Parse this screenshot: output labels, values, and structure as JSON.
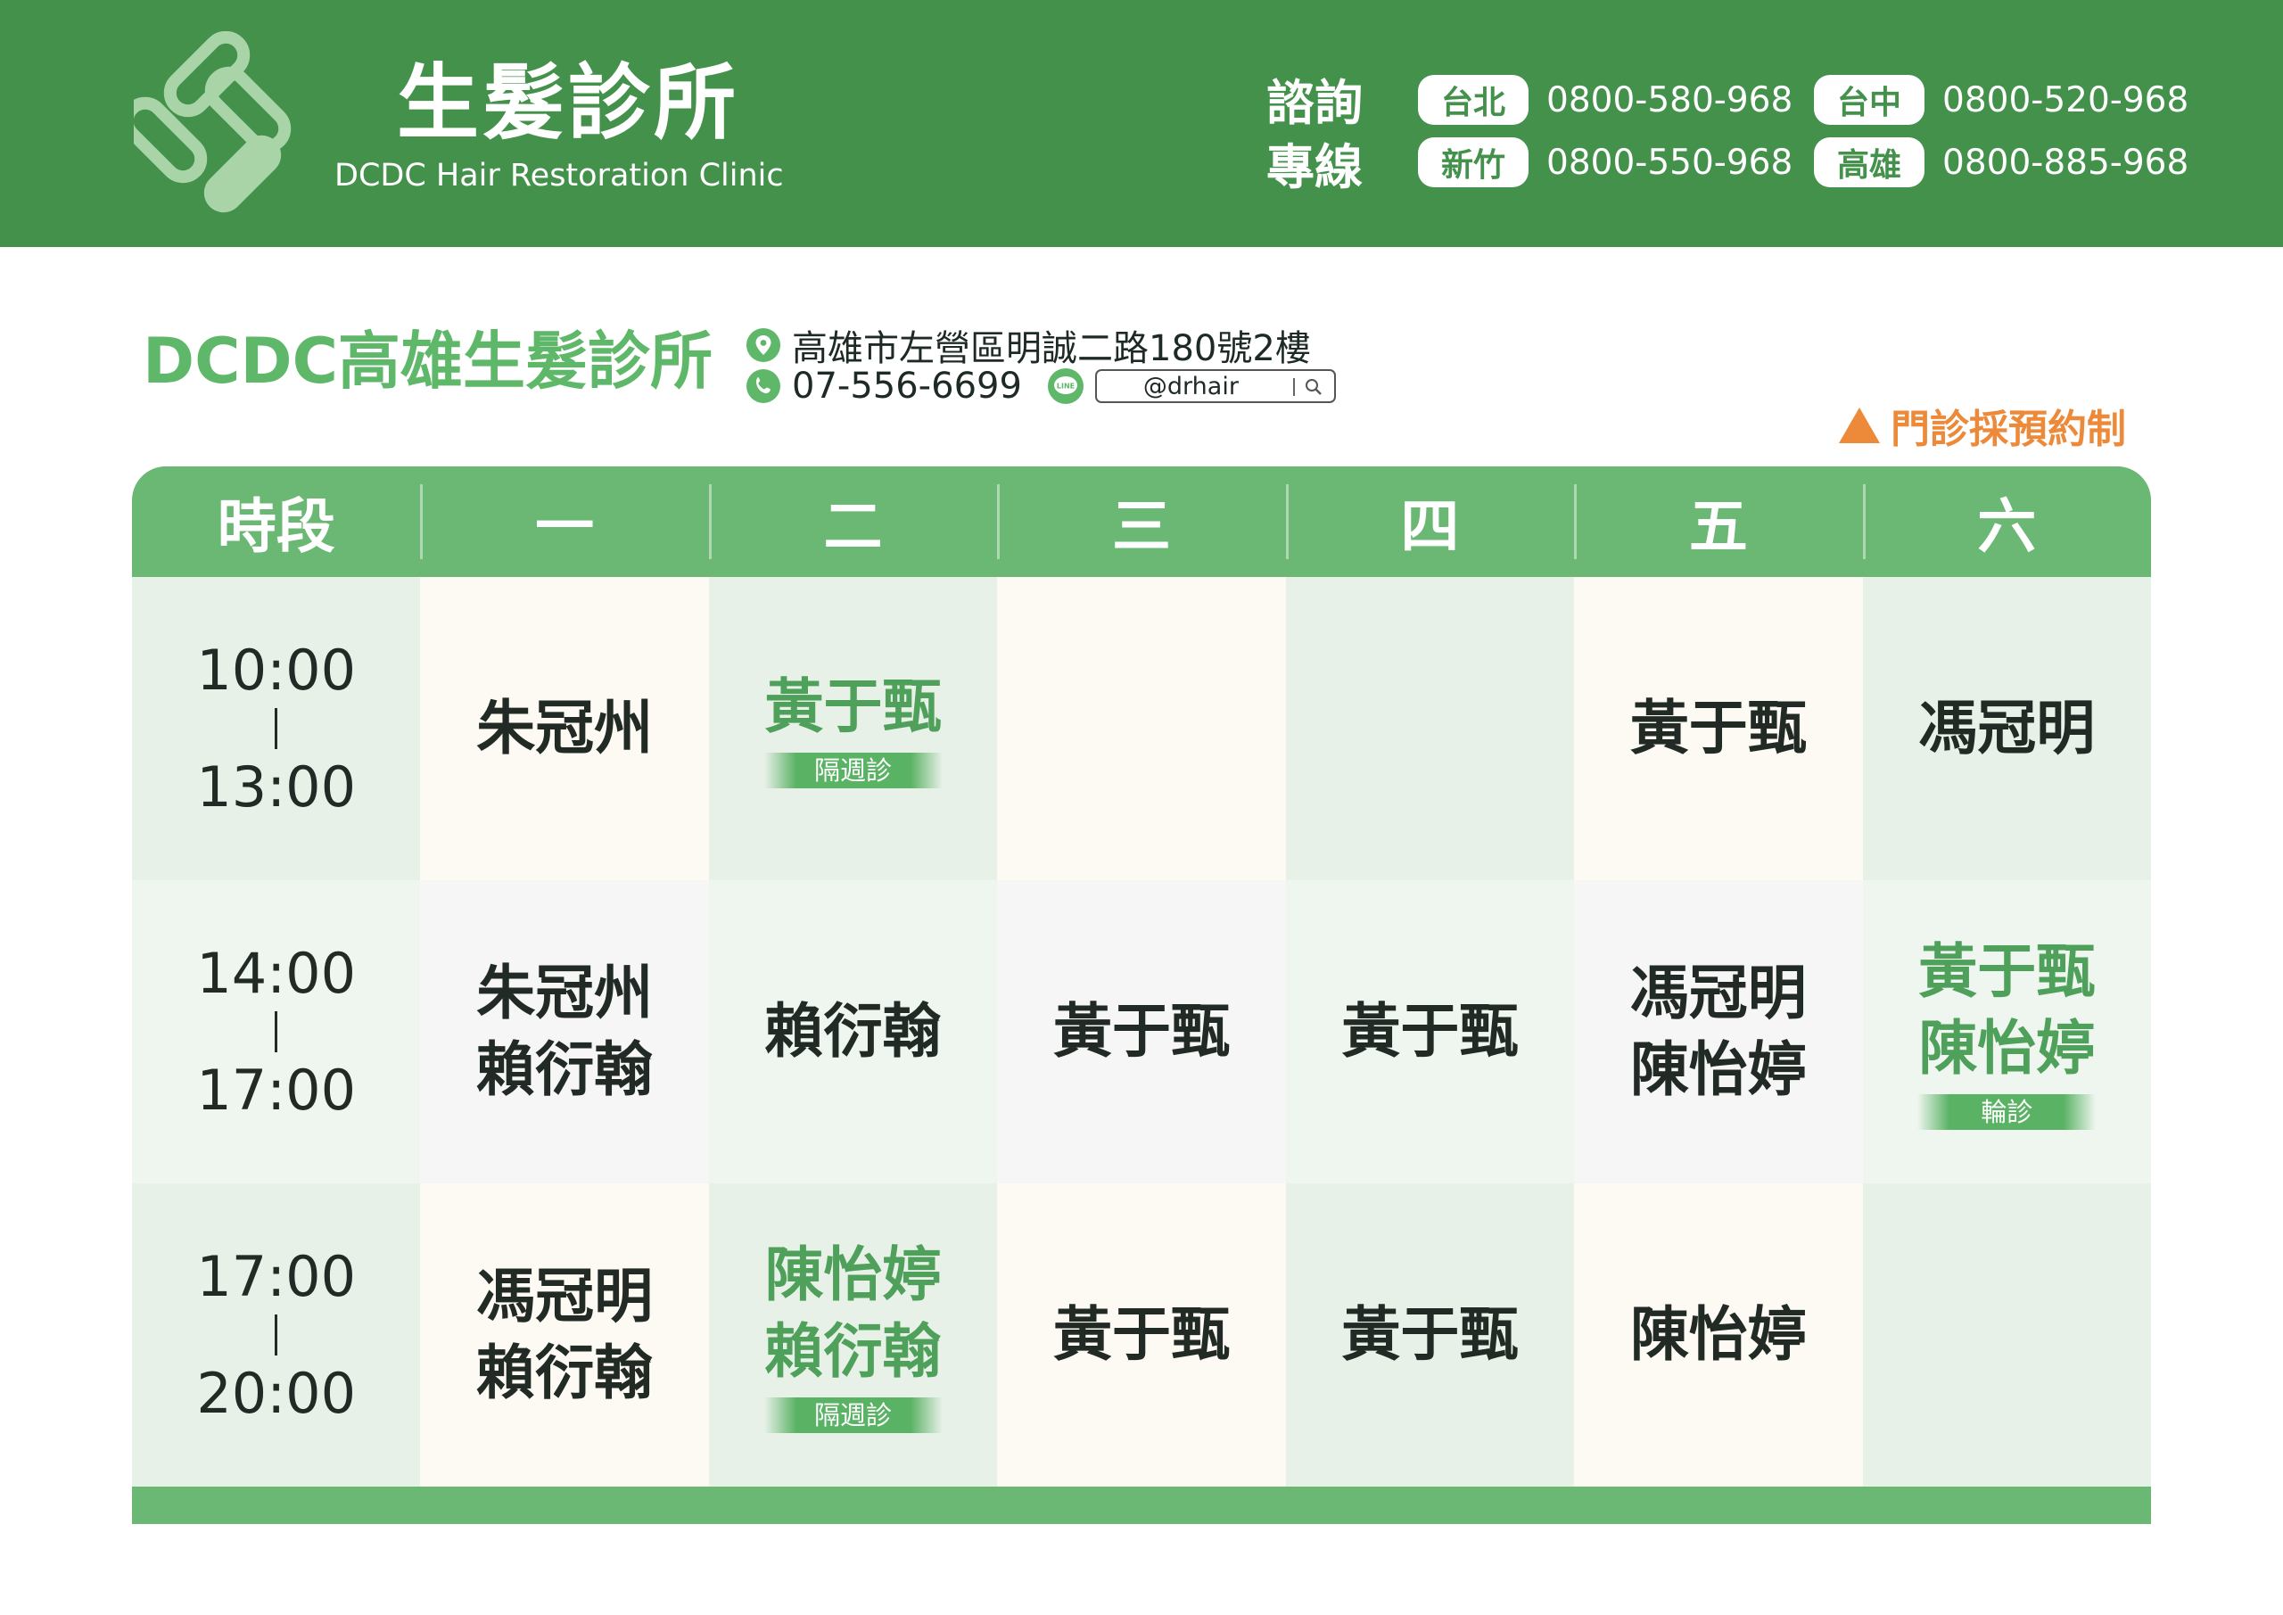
{
  "header": {
    "brand_title": "生髮診所",
    "brand_subtitle": "DCDC Hair Restoration Clinic",
    "consult_label_1": "諮詢",
    "consult_label_2": "專線",
    "hotlines": [
      {
        "city": "台北",
        "number": "0800-580-968"
      },
      {
        "city": "台中",
        "number": "0800-520-968"
      },
      {
        "city": "新竹",
        "number": "0800-550-968"
      },
      {
        "city": "高雄",
        "number": "0800-885-968"
      }
    ],
    "colors": {
      "brand_green": "#44914c",
      "table_green": "#6ab874",
      "accent_orange": "#ed8a3a"
    }
  },
  "clinic": {
    "name": "DCDC高雄生髮診所",
    "address": "高雄市左營區明誠二路180號2樓",
    "phone": "07-556-6699",
    "line_icon_text": "LINE",
    "line_id": "@drhair",
    "notice": "門診採預約制"
  },
  "table": {
    "headers": [
      "時段",
      "一",
      "二",
      "三",
      "四",
      "五",
      "六"
    ],
    "rows": [
      {
        "time_start": "10:00",
        "time_end": "13:00",
        "cells": [
          {
            "names": "朱冠州",
            "highlight": false,
            "tag": ""
          },
          {
            "names": "黃于甄",
            "highlight": true,
            "tag": "隔週診"
          },
          {
            "names": "",
            "highlight": false,
            "tag": ""
          },
          {
            "names": "",
            "highlight": false,
            "tag": ""
          },
          {
            "names": "黃于甄",
            "highlight": false,
            "tag": ""
          },
          {
            "names": "馮冠明",
            "highlight": false,
            "tag": ""
          }
        ]
      },
      {
        "time_start": "14:00",
        "time_end": "17:00",
        "cells": [
          {
            "names": "朱冠州\n賴衍翰",
            "highlight": false,
            "tag": ""
          },
          {
            "names": "賴衍翰",
            "highlight": false,
            "tag": ""
          },
          {
            "names": "黃于甄",
            "highlight": false,
            "tag": ""
          },
          {
            "names": "黃于甄",
            "highlight": false,
            "tag": ""
          },
          {
            "names": "馮冠明\n陳怡婷",
            "highlight": false,
            "tag": ""
          },
          {
            "names": "黃于甄\n陳怡婷",
            "highlight": true,
            "tag": "輪診"
          }
        ]
      },
      {
        "time_start": "17:00",
        "time_end": "20:00",
        "cells": [
          {
            "names": "馮冠明\n賴衍翰",
            "highlight": false,
            "tag": ""
          },
          {
            "names": "陳怡婷\n賴衍翰",
            "highlight": true,
            "tag": "隔週診"
          },
          {
            "names": "黃于甄",
            "highlight": false,
            "tag": ""
          },
          {
            "names": "黃于甄",
            "highlight": false,
            "tag": ""
          },
          {
            "names": "陳怡婷",
            "highlight": false,
            "tag": ""
          },
          {
            "names": "",
            "highlight": false,
            "tag": ""
          }
        ]
      }
    ]
  }
}
